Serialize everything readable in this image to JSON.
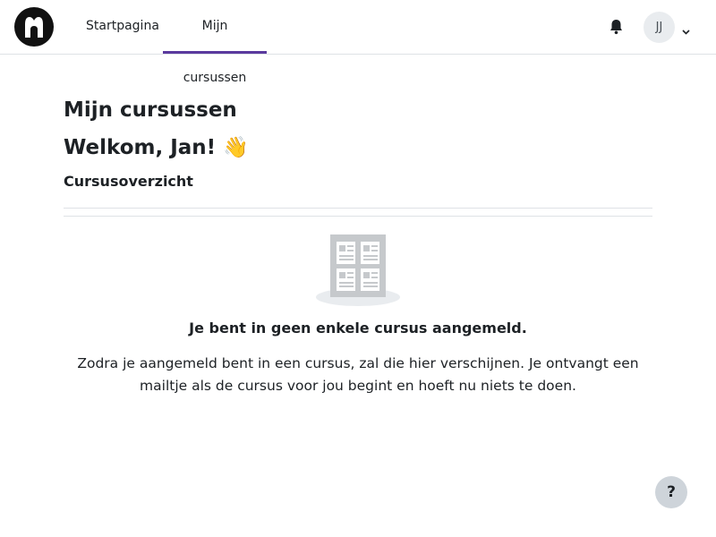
{
  "navbar": {
    "logo_icon": "site-logo-icon",
    "links": [
      {
        "label": "Startpagina"
      },
      {
        "label": "Mijn cursussen",
        "active": true
      }
    ],
    "notification_icon": "bell-icon",
    "user": {
      "initials": "JJ",
      "menu_icon": "chevron-down-icon"
    }
  },
  "main": {
    "page_title": "Mijn cursussen",
    "welcome": "Welkom, Jan!",
    "welcome_emoji": "👋",
    "section_title": "Cursusoverzicht",
    "empty_state": {
      "icon": "courses-grid-icon",
      "title": "Je bent in geen enkele cursus aangemeld.",
      "text": "Zodra je aangemeld bent in een cursus, zal die hier verschijnen. Je ontvangt een mailtje als de cursus voor jou begint en hoeft nu niets te doen."
    }
  },
  "help": {
    "label": "?"
  },
  "colors": {
    "accent": "#5b3a9e",
    "border": "#dee2e6",
    "avatar_bg": "#e9ecef",
    "help_bg": "#ced4da"
  }
}
